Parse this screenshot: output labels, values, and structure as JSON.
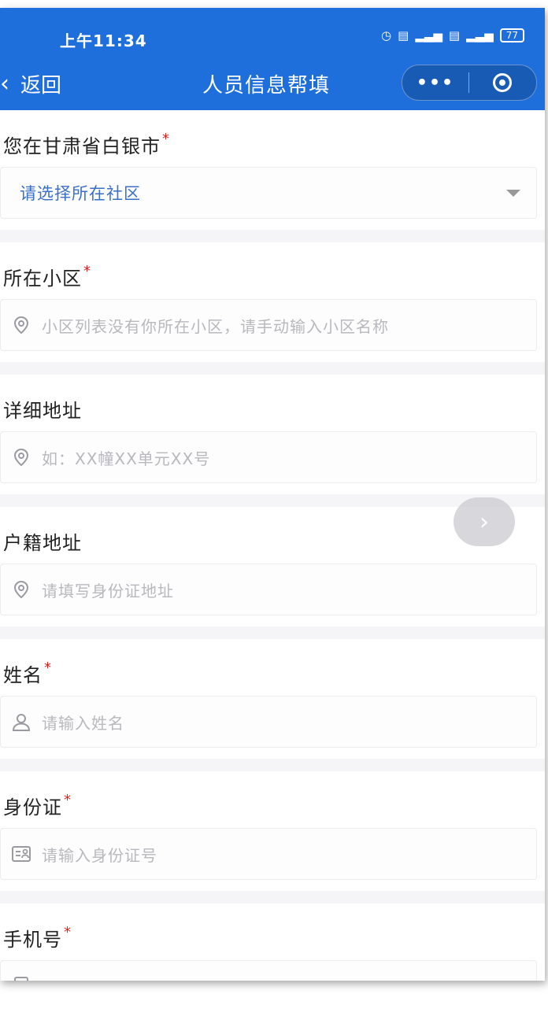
{
  "status_bar": {
    "time": "上午11:34",
    "battery": "77"
  },
  "nav": {
    "back_label": "返回",
    "title": "人员信息帮填"
  },
  "form": {
    "community": {
      "label": "您在甘肃省白银市",
      "required": "*",
      "value": "请选择所在社区"
    },
    "estate": {
      "label": "所在小区",
      "required": "*",
      "placeholder": "小区列表没有你所在小区，请手动输入小区名称",
      "icon": "location-pin-icon"
    },
    "address": {
      "label": "详细地址",
      "placeholder": "如：XX幢XX单元XX号",
      "icon": "location-pin-icon"
    },
    "household_address": {
      "label": "户籍地址",
      "placeholder": "请填写身份证地址",
      "icon": "location-pin-icon"
    },
    "name": {
      "label": "姓名",
      "required": "*",
      "placeholder": "请输入姓名",
      "icon": "user-icon"
    },
    "id_card": {
      "label": "身份证",
      "required": "*",
      "placeholder": "请输入身份证号",
      "icon": "id-card-icon"
    },
    "phone": {
      "label": "手机号",
      "required": "*",
      "icon": "phone-icon"
    }
  },
  "colors": {
    "nav_bg": "#1e6fdc",
    "required": "#e02020",
    "select_text": "#3a6fc8"
  }
}
